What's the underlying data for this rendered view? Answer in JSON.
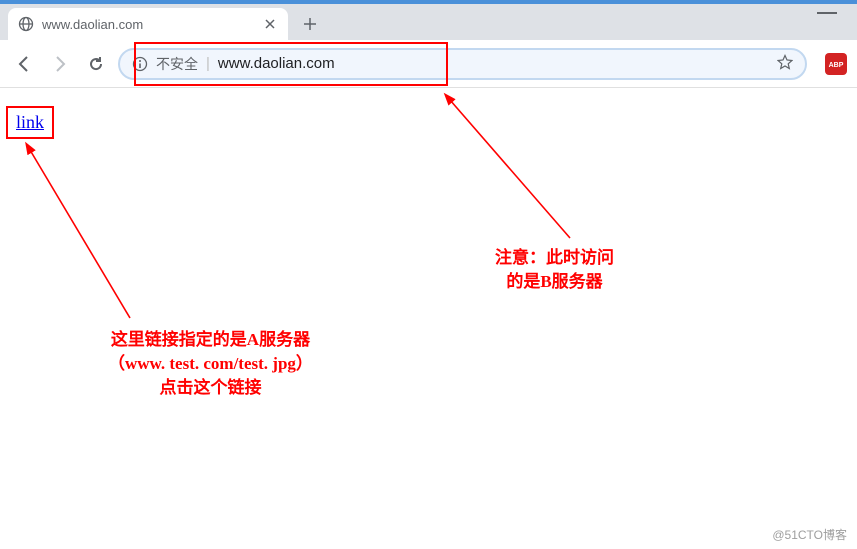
{
  "tab": {
    "title": "www.daolian.com"
  },
  "omnibox": {
    "security_label": "不安全",
    "url": "www.daolian.com"
  },
  "page": {
    "link_text": "link"
  },
  "annotations": {
    "right_line1": "注意：此时访问",
    "right_line2": "的是B服务器",
    "left_line1": "这里链接指定的是A服务器",
    "left_line2": "（www. test. com/test. jpg）",
    "left_line3": "点击这个链接"
  },
  "extension": {
    "abp_label": "ABP"
  },
  "watermark": "@51CTO博客"
}
